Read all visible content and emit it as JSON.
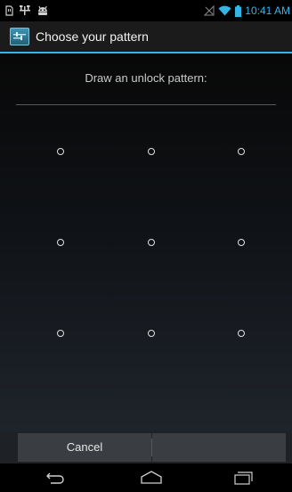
{
  "status_bar": {
    "time": "10:41 AM",
    "left_icons": [
      "sd-card-icon",
      "usb-icon",
      "android-debug-icon"
    ],
    "right_icons": [
      "no-signal-icon",
      "wifi-icon",
      "battery-icon"
    ],
    "accent_color": "#33b5e5"
  },
  "action_bar": {
    "title": "Choose your pattern",
    "icon": "app-settings-icon"
  },
  "content": {
    "header": "Draw an unlock pattern:",
    "grid_dots": 9
  },
  "buttons": {
    "cancel_label": "Cancel",
    "right_label": ""
  },
  "nav_bar": {
    "icons": [
      "back-icon",
      "home-icon",
      "recent-apps-icon"
    ]
  }
}
